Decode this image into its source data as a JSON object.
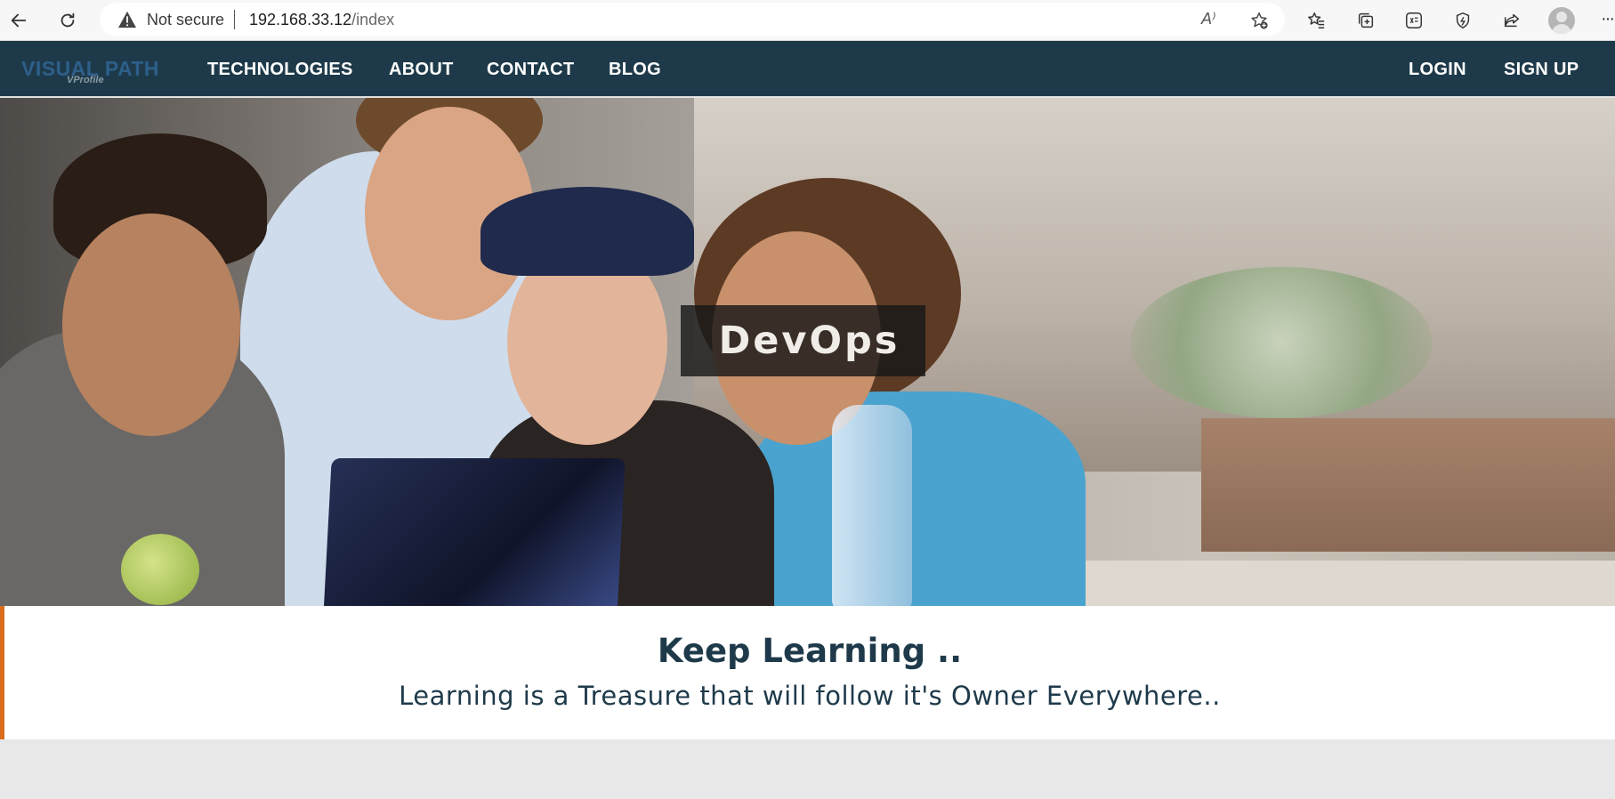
{
  "browser": {
    "security_label": "Not secure",
    "url_host": "192.168.33.12",
    "url_path": "/index",
    "read_aloud_glyph": "A⁾"
  },
  "nav": {
    "brand": "VISUAL PATH",
    "brand_sub": "VProfile",
    "items": [
      "TECHNOLOGIES",
      "ABOUT",
      "CONTACT",
      "BLOG"
    ],
    "right_items": [
      "LOGIN",
      "SIGN UP"
    ]
  },
  "hero": {
    "label": "DevOps"
  },
  "tagline": {
    "title": "Keep Learning ..",
    "subtitle": "Learning is a Treasure that will follow it's Owner Everywhere.."
  },
  "colors": {
    "nav_bg": "#1e3a4a",
    "accent": "#d96c1a",
    "brand": "#2d5f8a"
  },
  "icons": [
    "back-arrow-icon",
    "refresh-icon",
    "warning-icon",
    "read-aloud-icon",
    "add-favorite-icon",
    "favorites-icon",
    "collections-icon",
    "math-solver-icon",
    "browser-essentials-icon",
    "share-icon",
    "profile-avatar-icon",
    "more-options-icon"
  ]
}
